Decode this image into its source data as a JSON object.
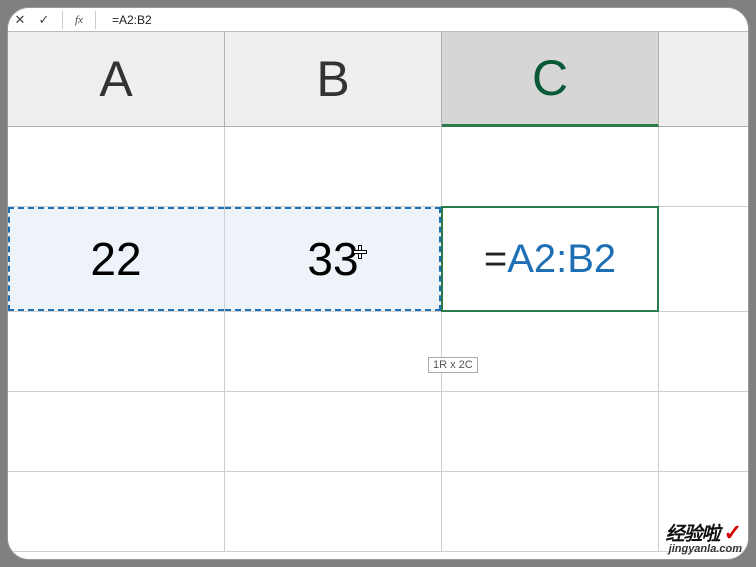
{
  "formula_bar": {
    "cancel": "✕",
    "accept": "✓",
    "fx": "fx",
    "content": "=A2:B2"
  },
  "columns": {
    "A": "A",
    "B": "B",
    "C": "C"
  },
  "cells": {
    "A2": "22",
    "B2": "33",
    "C2_eq": "=",
    "C2_ref": "A2:B2"
  },
  "selection_tip": "1R x 2C",
  "watermark": {
    "line1": "经验啦",
    "check": "✓",
    "line2": "jingyanla.com"
  }
}
